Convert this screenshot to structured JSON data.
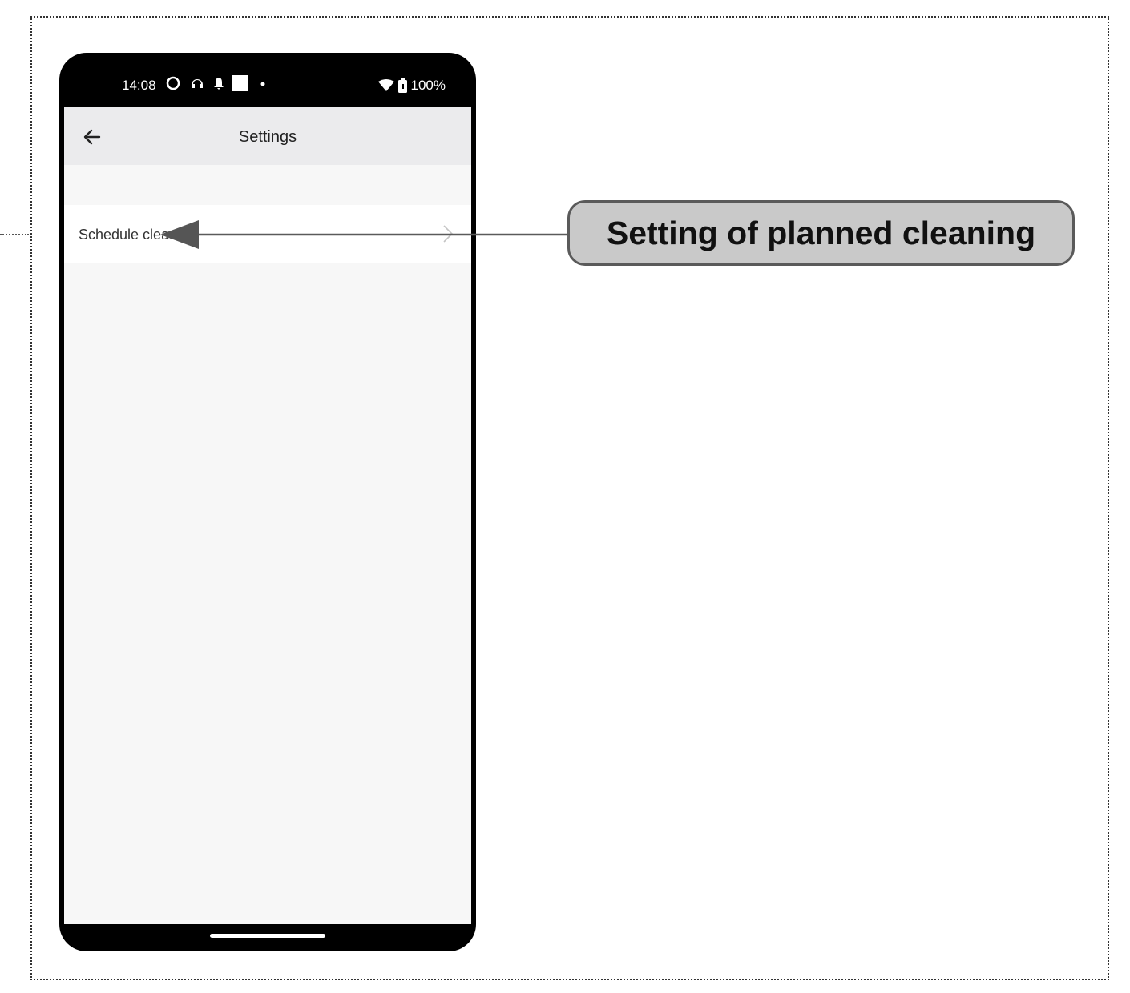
{
  "status_bar": {
    "time": "14:08",
    "battery": "100%"
  },
  "app_bar": {
    "title": "Settings"
  },
  "settings": {
    "items": [
      {
        "label": "Schedule cleaning"
      }
    ]
  },
  "annotation": {
    "callout": "Setting of planned cleaning"
  },
  "colors": {
    "phone_frame": "#000000",
    "app_bar_bg": "#ebebed",
    "screen_bg": "#f7f7f7",
    "callout_bg": "#c9c9c9",
    "callout_border": "#5a5a5a"
  },
  "icons": {
    "back": "arrow-left-icon",
    "chevron": "chevron-right-icon",
    "wifi": "wifi-icon",
    "battery": "battery-icon"
  }
}
